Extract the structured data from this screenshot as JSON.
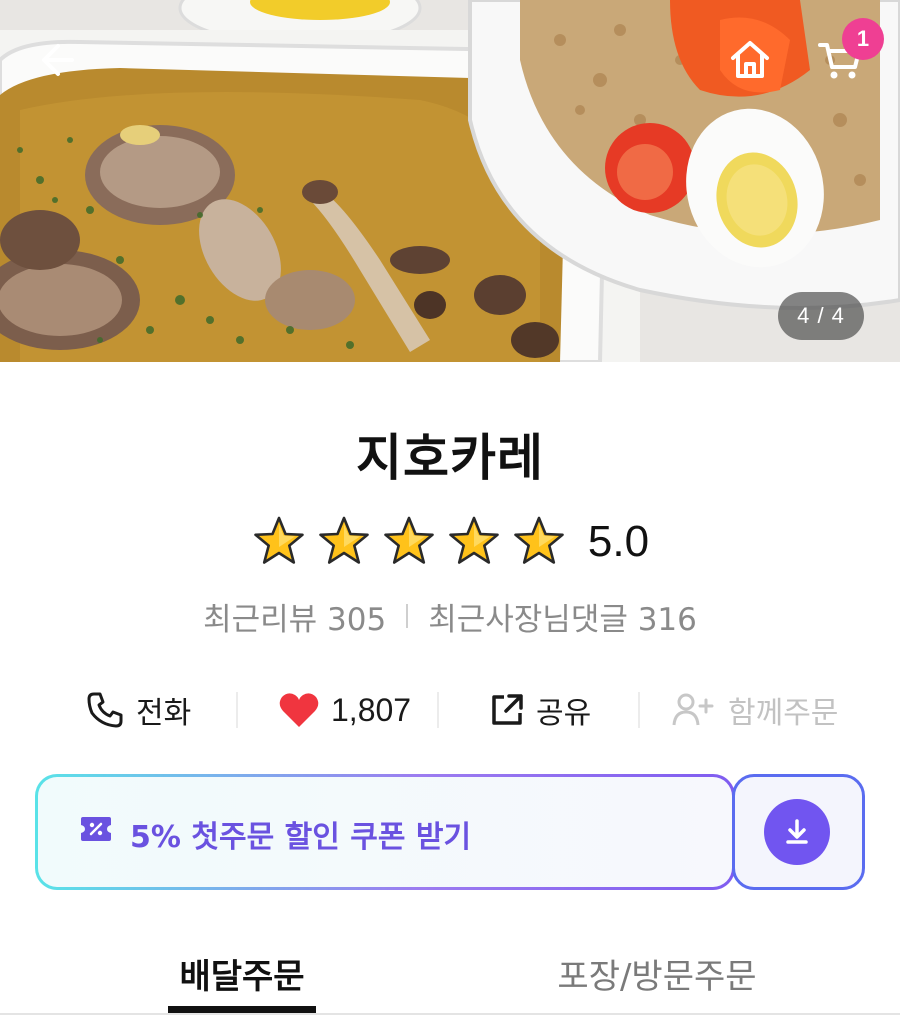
{
  "header": {
    "cart_count": "1",
    "photo_index": "4 / 4"
  },
  "store": {
    "name": "지호카레",
    "rating": "5.0",
    "stars": 5,
    "recent_reviews": "최근리뷰 305",
    "owner_replies": "최근사장님댓글 316"
  },
  "actions": {
    "call": "전화",
    "likes": "1,807",
    "share": "공유",
    "group_order": "함께주문"
  },
  "coupon": {
    "text": "5% 첫주문 할인 쿠폰 받기"
  },
  "tabs": [
    {
      "label": "배달주문",
      "active": true
    },
    {
      "label": "포장/방문주문",
      "active": false
    }
  ],
  "colors": {
    "accent": "#7155f0",
    "badge": "#ef3f93",
    "heart": "#f0353f",
    "star": "#ffc21a"
  },
  "icons": [
    "back-arrow-icon",
    "home-icon",
    "cart-icon",
    "phone-icon",
    "heart-icon",
    "share-icon",
    "add-person-icon",
    "coupon-icon",
    "download-icon",
    "star-icon"
  ]
}
